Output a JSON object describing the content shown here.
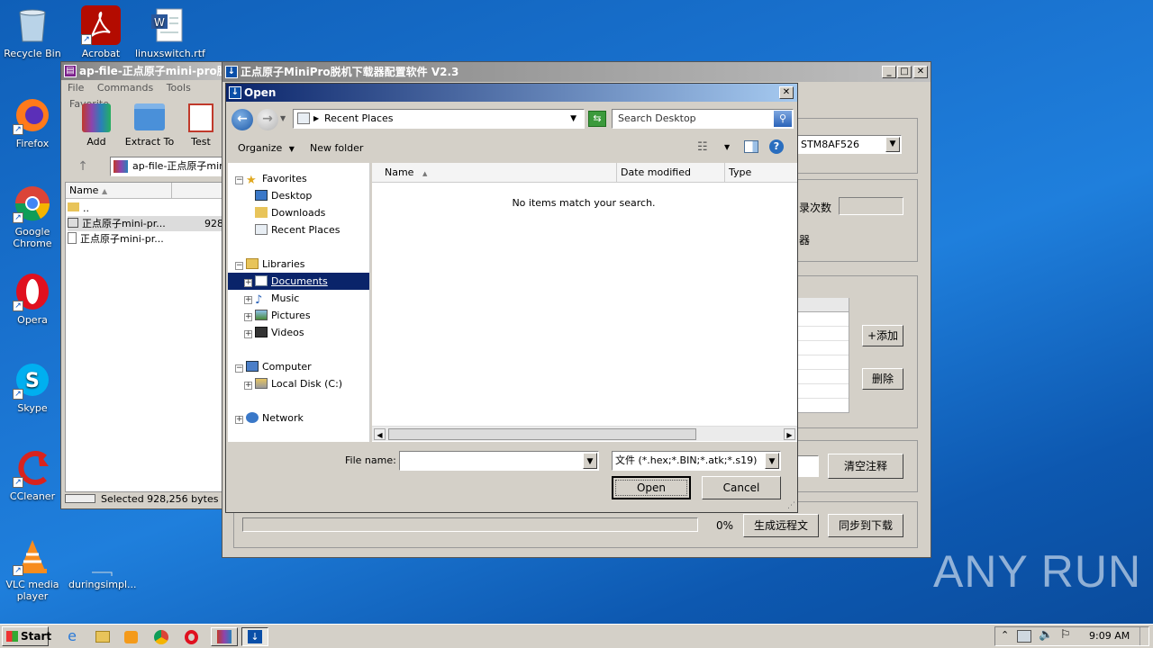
{
  "desktop": {
    "icons": [
      {
        "label": "Recycle Bin",
        "icon": "recycle-bin-icon"
      },
      {
        "label": "Acrobat",
        "icon": "acrobat-icon"
      },
      {
        "label": "linuxswitch.rtf",
        "icon": "word-document-icon"
      },
      {
        "label": "Firefox",
        "icon": "firefox-icon"
      },
      {
        "label": "Google Chrome",
        "icon": "chrome-icon"
      },
      {
        "label": "Opera",
        "icon": "opera-icon"
      },
      {
        "label": "Skype",
        "icon": "skype-icon"
      },
      {
        "label": "CCleaner",
        "icon": "ccleaner-icon"
      },
      {
        "label": "VLC media player",
        "icon": "vlc-icon"
      },
      {
        "label": "duringsimpl...",
        "icon": "blank-file-icon"
      }
    ],
    "watermark": "ANY RUN"
  },
  "winrar": {
    "title": "ap-file-正点原子mini-pro脱",
    "menu": [
      "File",
      "Commands",
      "Tools",
      "Favorite"
    ],
    "toolbar": [
      "Add",
      "Extract To",
      "Test"
    ],
    "path": "ap-file-正点原子mini",
    "columns": {
      "name": "Name"
    },
    "rows": [
      {
        "name": "..",
        "size": ""
      },
      {
        "name": "正点原子mini-pr...",
        "size": "928"
      },
      {
        "name": "正点原子mini-pr...",
        "size": ""
      }
    ],
    "status": "Selected 928,256 bytes in"
  },
  "minipro": {
    "title": "正点原子MiniPro脱机下载器配置软件 V2.3",
    "chip_select": "STM8AF526",
    "count_label": "录次数",
    "device_label": "器",
    "add_button": "+添加",
    "delete_button": "删除",
    "clear_button": "清空注释",
    "progress_value": "0%",
    "generate_button": "生成远程文",
    "sync_button": "同步到下载"
  },
  "open_dialog": {
    "title": "Open",
    "location": "Recent Places",
    "search_placeholder": "Search Desktop",
    "organize": "Organize",
    "new_folder": "New folder",
    "nav": {
      "favorites": "Favorites",
      "desktop": "Desktop",
      "downloads": "Downloads",
      "recent": "Recent Places",
      "libraries": "Libraries",
      "documents": "Documents",
      "music": "Music",
      "pictures": "Pictures",
      "videos": "Videos",
      "computer": "Computer",
      "local_disk": "Local Disk (C:)",
      "network": "Network"
    },
    "columns": {
      "name": "Name",
      "date": "Date modified",
      "type": "Type"
    },
    "empty_message": "No items match your search.",
    "file_name_label": "File name:",
    "file_name_value": "",
    "file_type": "文件 (*.hex;*.BIN;*.atk;*.s19)",
    "open_button": "Open",
    "cancel_button": "Cancel"
  },
  "taskbar": {
    "start": "Start",
    "clock": "9:09 AM"
  }
}
